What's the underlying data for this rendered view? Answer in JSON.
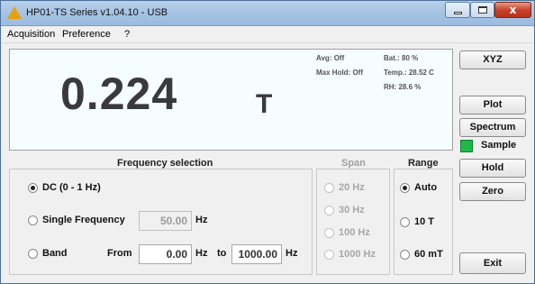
{
  "window": {
    "title": "HP01-TS Series v1.04.10 - USB",
    "close_glyph": "x"
  },
  "menu": [
    "Acquisition",
    "Preference",
    "?"
  ],
  "display": {
    "value": "0.224",
    "unit": "T",
    "avg": "Avg: Off",
    "max_hold": "Max Hold: Off",
    "battery": "Bat.: 80 %",
    "temperature": "Temp.: 28.52 C",
    "humidity": "RH: 28.6 %"
  },
  "buttons": {
    "xyz": "XYZ",
    "plot": "Plot",
    "spectrum": "Spectrum",
    "sample": "Sample",
    "hold": "Hold",
    "zero": "Zero",
    "exit": "Exit"
  },
  "frequency": {
    "header": "Frequency selection",
    "options": {
      "dc": "DC (0 - 1 Hz)",
      "single": "Single Frequency",
      "band": "Band"
    },
    "selected": "dc",
    "single_value": "50.00",
    "single_unit": "Hz",
    "band_from_label": "From",
    "band_from_value": "0.00",
    "band_from_unit": "Hz",
    "band_to_label": "to",
    "band_to_value": "1000.00",
    "band_to_unit": "Hz"
  },
  "span": {
    "header": "Span",
    "options": [
      "20 Hz",
      "30 Hz",
      "100 Hz",
      "1000 Hz"
    ]
  },
  "range": {
    "header": "Range",
    "options": [
      "Auto",
      "10 T",
      "60 mT"
    ],
    "selected": "Auto"
  },
  "colors": {
    "sample_indicator": "#1fb84a",
    "display_background": "#f5fdfd"
  }
}
